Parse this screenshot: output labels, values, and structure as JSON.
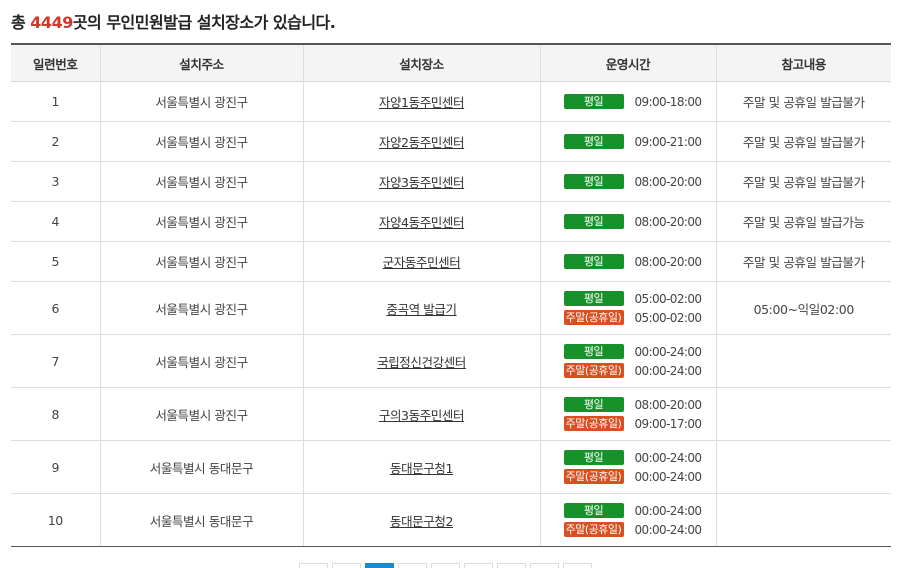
{
  "summary": {
    "prefix": "총 ",
    "count": "4449",
    "suffix": "곳의 무인민원발급 설치장소가 있습니다."
  },
  "colors": {
    "count_highlight": "#d8352a",
    "weekday_badge": "#17922b",
    "holiday_badge": "#d85020",
    "pager_active": "#1a8ad0"
  },
  "table": {
    "headers": [
      "일련번호",
      "설치주소",
      "설치장소",
      "운영시간",
      "참고내용"
    ],
    "rows": [
      {
        "no": "1",
        "address": "서울특별시 광진구",
        "place": "자양1동주민센터",
        "hours": [
          {
            "badge": "평일",
            "type": "weekday",
            "time": "09:00-18:00"
          }
        ],
        "note": "주말 및 공휴일 발급불가"
      },
      {
        "no": "2",
        "address": "서울특별시 광진구",
        "place": "자양2동주민센터",
        "hours": [
          {
            "badge": "평일",
            "type": "weekday",
            "time": "09:00-21:00"
          }
        ],
        "note": "주말 및 공휴일 발급불가"
      },
      {
        "no": "3",
        "address": "서울특별시 광진구",
        "place": "자양3동주민센터",
        "hours": [
          {
            "badge": "평일",
            "type": "weekday",
            "time": "08:00-20:00"
          }
        ],
        "note": "주말 및 공휴일 발급불가"
      },
      {
        "no": "4",
        "address": "서울특별시 광진구",
        "place": "자양4동주민센터",
        "hours": [
          {
            "badge": "평일",
            "type": "weekday",
            "time": "08:00-20:00"
          }
        ],
        "note": "주말 및 공휴일 발급가능"
      },
      {
        "no": "5",
        "address": "서울특별시 광진구",
        "place": "군자동주민센터",
        "hours": [
          {
            "badge": "평일",
            "type": "weekday",
            "time": "08:00-20:00"
          }
        ],
        "note": "주말 및 공휴일 발급불가"
      },
      {
        "no": "6",
        "address": "서울특별시 광진구",
        "place": "중곡역 발급기",
        "hours": [
          {
            "badge": "평일",
            "type": "weekday",
            "time": "05:00-02:00"
          },
          {
            "badge": "주말(공휴일)",
            "type": "holiday",
            "time": "05:00-02:00"
          }
        ],
        "note": "05:00~익일02:00"
      },
      {
        "no": "7",
        "address": "서울특별시 광진구",
        "place": "국립정신건강센터",
        "hours": [
          {
            "badge": "평일",
            "type": "weekday",
            "time": "00:00-24:00"
          },
          {
            "badge": "주말(공휴일)",
            "type": "holiday",
            "time": "00:00-24:00"
          }
        ],
        "note": ""
      },
      {
        "no": "8",
        "address": "서울특별시 광진구",
        "place": "구의3동주민센터",
        "hours": [
          {
            "badge": "평일",
            "type": "weekday",
            "time": "08:00-20:00"
          },
          {
            "badge": "주말(공휴일)",
            "type": "holiday",
            "time": "09:00-17:00"
          }
        ],
        "note": ""
      },
      {
        "no": "9",
        "address": "서울특별시 동대문구",
        "place": "동대문구청1",
        "hours": [
          {
            "badge": "평일",
            "type": "weekday",
            "time": "00:00-24:00"
          },
          {
            "badge": "주말(공휴일)",
            "type": "holiday",
            "time": "00:00-24:00"
          }
        ],
        "note": ""
      },
      {
        "no": "10",
        "address": "서울특별시 동대문구",
        "place": "동대문구청2",
        "hours": [
          {
            "badge": "평일",
            "type": "weekday",
            "time": "00:00-24:00"
          },
          {
            "badge": "주말(공휴일)",
            "type": "holiday",
            "time": "00:00-24:00"
          }
        ],
        "note": ""
      }
    ]
  },
  "pager": {
    "visible_buttons": 9,
    "active_index": 2
  }
}
